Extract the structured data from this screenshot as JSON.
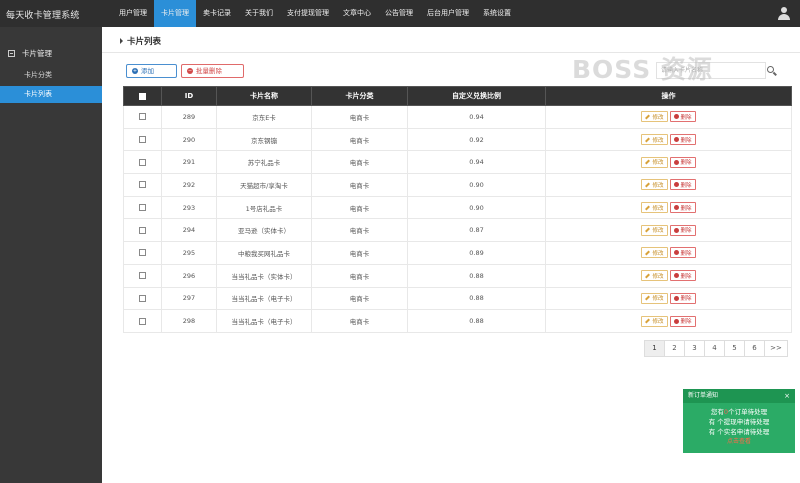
{
  "brand": "每天收卡管理系统",
  "nav": [
    "用户管理",
    "卡片管理",
    "卖卡记录",
    "关于我们",
    "支付提现管理",
    "文章中心",
    "公告管理",
    "后台用户管理",
    "系统设置"
  ],
  "nav_active": 1,
  "sidebar": {
    "group": "卡片管理",
    "items": [
      "卡片分类",
      "卡片列表"
    ]
  },
  "page_title": "卡片列表",
  "toolbar": {
    "add_label": "添加",
    "batch_delete_label": "批量删除"
  },
  "watermark": "BOSS 资源",
  "search": {
    "placeholder": "请输入卡片名称"
  },
  "table": {
    "headers": [
      "ID",
      "卡片名称",
      "卡片分类",
      "自定义兑换比例",
      "操作"
    ],
    "edit_label": "修改",
    "delete_label": "删除",
    "rows": [
      {
        "id": "289",
        "name": "京东E卡",
        "category": "电商卡",
        "ratio": "0.94"
      },
      {
        "id": "290",
        "name": "京东钢镚",
        "category": "电商卡",
        "ratio": "0.92"
      },
      {
        "id": "291",
        "name": "苏宁礼品卡",
        "category": "电商卡",
        "ratio": "0.94"
      },
      {
        "id": "292",
        "name": "天猫超市/享淘卡",
        "category": "电商卡",
        "ratio": "0.90"
      },
      {
        "id": "293",
        "name": "1号店礼品卡",
        "category": "电商卡",
        "ratio": "0.90"
      },
      {
        "id": "294",
        "name": "亚马逊（实体卡）",
        "category": "电商卡",
        "ratio": "0.87"
      },
      {
        "id": "295",
        "name": "中粮我买网礼品卡",
        "category": "电商卡",
        "ratio": "0.89"
      },
      {
        "id": "296",
        "name": "当当礼品卡（实体卡）",
        "category": "电商卡",
        "ratio": "0.88"
      },
      {
        "id": "297",
        "name": "当当礼品卡（电子卡）",
        "category": "电商卡",
        "ratio": "0.88"
      },
      {
        "id": "298",
        "name": "当当礼品卡（电子卡）",
        "category": "电商卡",
        "ratio": "0.88"
      }
    ]
  },
  "pagination": {
    "pages": [
      "1",
      "2",
      "3",
      "4",
      "5",
      "6"
    ],
    "next": ">>",
    "current": "1"
  },
  "notice": {
    "title": "新订单通知",
    "close": "×",
    "line1_pre": "您有",
    "line1_num": "0",
    "line1_post": "个订单待处理",
    "line2": "有  个提现申请待处理",
    "line3": "有  个实名申请待处理",
    "link": "点击查看"
  }
}
